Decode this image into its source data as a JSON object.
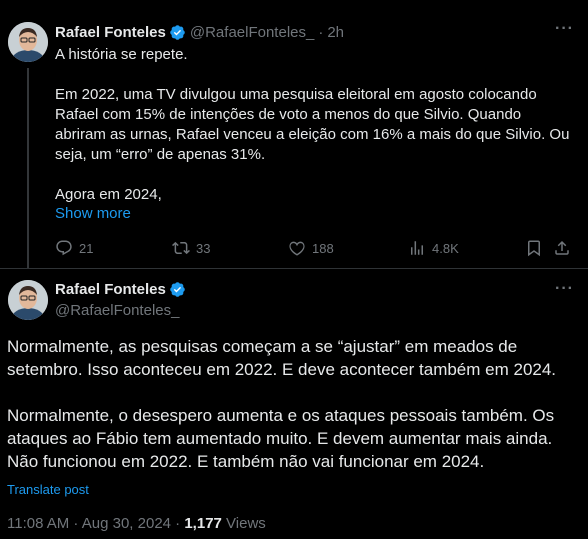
{
  "colors": {
    "background": "#000000",
    "text": "#e7e9ea",
    "muted": "#71767b",
    "accent": "#1d9bf0",
    "divider": "#2f3336"
  },
  "tweet1": {
    "name": "Rafael Fonteles",
    "handle": "@RafaelFonteles_",
    "separator": "·",
    "time": "2h",
    "more_label": "···",
    "paragraphs": [
      "A história se repete.",
      "Em 2022, uma TV divulgou uma pesquisa eleitoral em agosto colocando Rafael com 15% de intenções de voto a menos do que Silvio. Quando abriram as urnas, Rafael venceu a eleição com 16% a mais do que Silvio. Ou seja, um “erro” de apenas 31%.",
      "Agora em 2024,"
    ],
    "show_more": "Show more",
    "actions": {
      "replies": "21",
      "reposts": "33",
      "likes": "188",
      "views": "4.8K",
      "icons": [
        "reply-icon",
        "repost-icon",
        "like-icon",
        "views-icon",
        "bookmark-icon",
        "share-icon"
      ]
    }
  },
  "tweet2": {
    "name": "Rafael Fonteles",
    "handle": "@RafaelFonteles_",
    "more_label": "···",
    "paragraph1": "Normalmente, as pesquisas começam a se “ajustar” em meados de setembro. Isso aconteceu em 2022. E deve acontecer também em 2024.",
    "paragraph2": "Normalmente, o desespero aumenta e os ataques pessoais também. Os ataques ao Fábio tem aumentado muito. E devem aumentar mais ainda. Não funcionou em 2022. E também não vai funcionar em 2024.",
    "translate": "Translate post",
    "timestamp": "11:08 AM · Aug 30, 2024 · ",
    "views_count": "1,177",
    "views_label": " Views"
  }
}
